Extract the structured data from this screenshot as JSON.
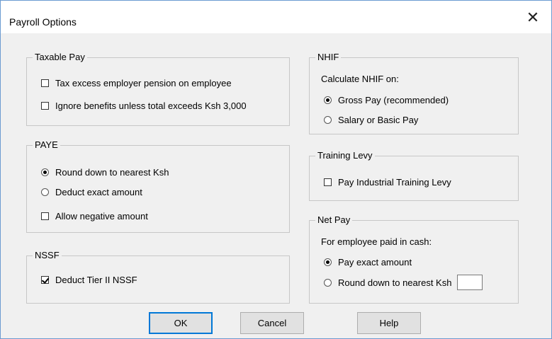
{
  "window": {
    "title": "Payroll Options",
    "close_symbol": "✕"
  },
  "taxable_pay": {
    "legend": "Taxable Pay",
    "options": [
      {
        "label": "Tax excess employer pension on employee",
        "checked": false
      },
      {
        "label": "Ignore benefits unless total exceeds Ksh 3,000",
        "checked": false
      }
    ]
  },
  "paye": {
    "legend": "PAYE",
    "radios": [
      {
        "label": "Round down to nearest Ksh",
        "selected": true
      },
      {
        "label": "Deduct exact amount",
        "selected": false
      }
    ],
    "checkbox": {
      "label": "Allow negative amount",
      "checked": false
    }
  },
  "nssf": {
    "legend": "NSSF",
    "checkbox": {
      "label": "Deduct Tier II NSSF",
      "checked": true
    }
  },
  "nhif": {
    "legend": "NHIF",
    "prompt": "Calculate NHIF on:",
    "radios": [
      {
        "label": "Gross Pay (recommended)",
        "selected": true
      },
      {
        "label": "Salary or Basic Pay",
        "selected": false
      }
    ]
  },
  "training_levy": {
    "legend": "Training Levy",
    "checkbox": {
      "label": "Pay Industrial Training Levy",
      "checked": false
    }
  },
  "net_pay": {
    "legend": "Net Pay",
    "prompt": "For employee paid in cash:",
    "radios": [
      {
        "label": "Pay exact amount",
        "selected": true
      },
      {
        "label": "Round down to nearest Ksh",
        "selected": false
      }
    ],
    "round_value": ""
  },
  "buttons": {
    "ok": "OK",
    "cancel": "Cancel",
    "help": "Help"
  }
}
